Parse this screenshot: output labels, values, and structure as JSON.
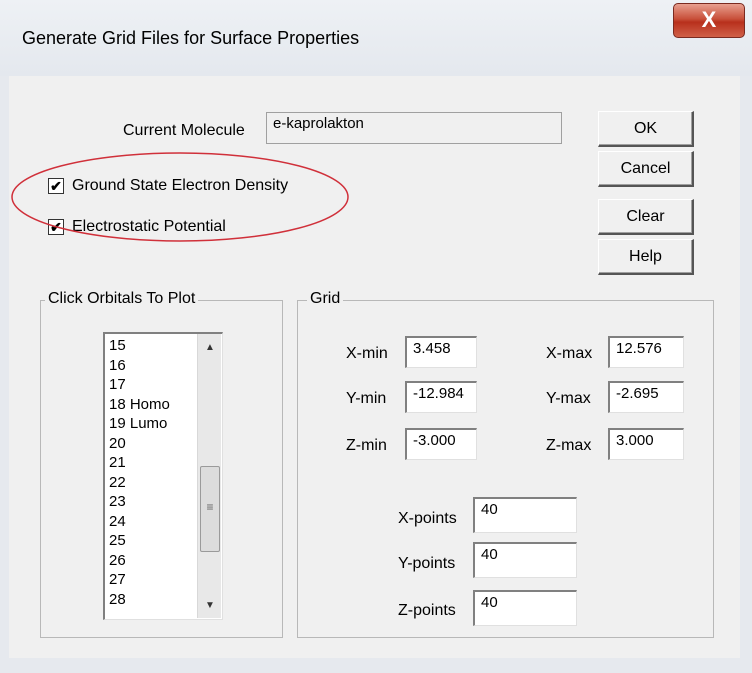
{
  "window": {
    "title": "Generate Grid Files for Surface Properties",
    "close_label": "X"
  },
  "buttons": {
    "ok": "OK",
    "cancel": "Cancel",
    "clear": "Clear",
    "help": "Help"
  },
  "molecule": {
    "label": "Current Molecule",
    "value": "e-kaprolakton"
  },
  "options": {
    "ground_state": {
      "label": "Ground State Electron Density",
      "checked": true
    },
    "electrostatic": {
      "label": "Electrostatic Potential",
      "checked": true
    }
  },
  "orbitals": {
    "title": "Click Orbitals To Plot",
    "items": [
      "15",
      "16",
      "17",
      "18 Homo",
      "19 Lumo",
      "20",
      "21",
      "22",
      "23",
      "24",
      "25",
      "26",
      "27",
      "28"
    ]
  },
  "grid": {
    "title": "Grid",
    "x_min_label": "X-min",
    "x_min": "3.458",
    "x_max_label": "X-max",
    "x_max": "12.576",
    "y_min_label": "Y-min",
    "y_min": "-12.984",
    "y_max_label": "Y-max",
    "y_max": "-2.695",
    "z_min_label": "Z-min",
    "z_min": "-3.000",
    "z_max_label": "Z-max",
    "z_max": "3.000",
    "x_points_label": "X-points",
    "x_points": "40",
    "y_points_label": "Y-points",
    "y_points": "40",
    "z_points_label": "Z-points",
    "z_points": "40"
  },
  "annotation_color": "#d0303a",
  "check_glyph": "✔"
}
